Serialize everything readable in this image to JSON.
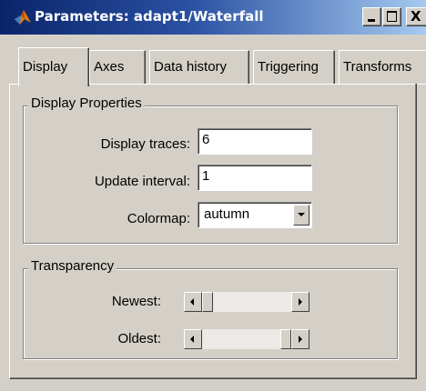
{
  "window": {
    "title": "Parameters: adapt1/Waterfall",
    "minimize_icon": "minimize-icon",
    "maximize_icon": "maximize-icon",
    "close_icon": "close-icon",
    "close_glyph": "X",
    "app_icon": "matlab-icon"
  },
  "tabs": [
    {
      "label": "Display",
      "active": true
    },
    {
      "label": "Axes",
      "active": false
    },
    {
      "label": "Data history",
      "active": false
    },
    {
      "label": "Triggering",
      "active": false
    },
    {
      "label": "Transforms",
      "active": false
    }
  ],
  "display_properties": {
    "group_label": "Display Properties",
    "traces_label": "Display traces:",
    "traces_value": "6",
    "interval_label": "Update interval:",
    "interval_value": "1",
    "colormap_label": "Colormap:",
    "colormap_value": "autumn"
  },
  "transparency": {
    "group_label": "Transparency",
    "newest_label": "Newest:",
    "newest_level": 0.0,
    "oldest_label": "Oldest:",
    "oldest_level": 1.0
  },
  "colors": {
    "face": "#d4d0c8",
    "title_gradient_start": "#0a246a",
    "title_gradient_end": "#a6caf0"
  }
}
